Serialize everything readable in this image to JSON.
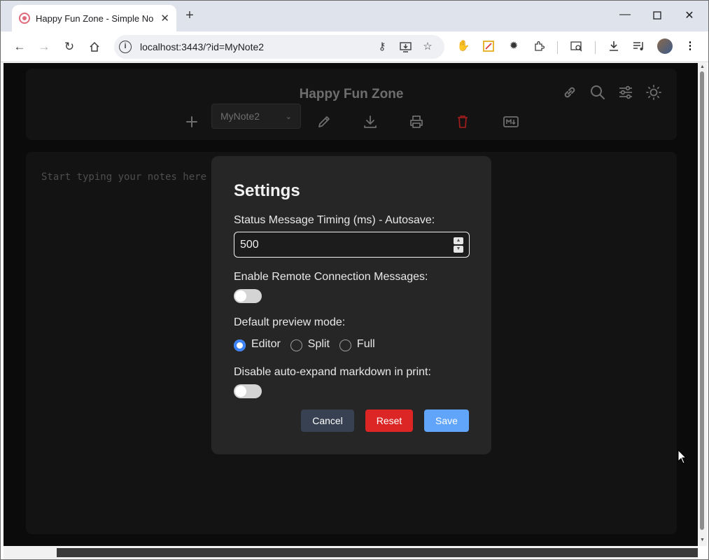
{
  "browser": {
    "tab_title": "Happy Fun Zone - Simple Notes",
    "url": "localhost:3443/?id=MyNote2"
  },
  "app": {
    "title": "Happy Fun Zone",
    "selected_note": "MyNote2",
    "editor_placeholder": "Start typing your notes here"
  },
  "settings": {
    "title": "Settings",
    "timing_label": "Status Message Timing (ms) - Autosave:",
    "timing_value": "500",
    "remote_label": "Enable Remote Connection Messages:",
    "remote_enabled": false,
    "preview_label": "Default preview mode:",
    "preview_options": [
      "Editor",
      "Split",
      "Full"
    ],
    "preview_selected": "Editor",
    "print_label": "Disable auto-expand markdown in print:",
    "print_disabled": false,
    "cancel_label": "Cancel",
    "reset_label": "Reset",
    "save_label": "Save"
  },
  "colors": {
    "cancel": "#374151",
    "reset": "#dc2626",
    "save": "#60a5fa",
    "delete_icon": "#9b1c1c",
    "radio_checked": "#3b82f6"
  }
}
